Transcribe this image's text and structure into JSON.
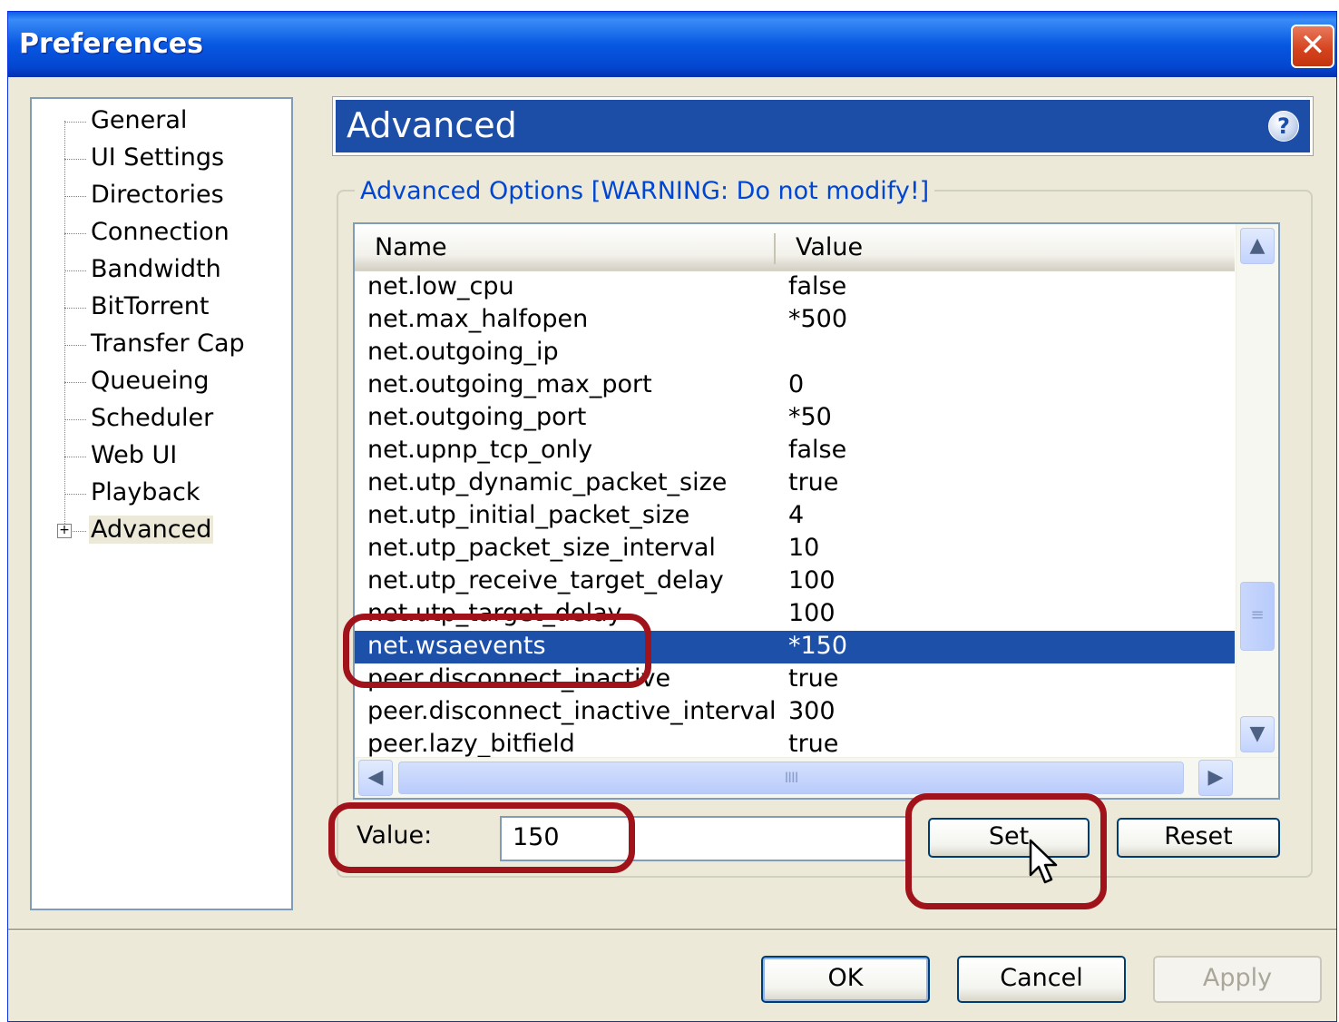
{
  "window": {
    "title": "Preferences"
  },
  "tree": {
    "items": [
      {
        "label": "General"
      },
      {
        "label": "UI Settings"
      },
      {
        "label": "Directories"
      },
      {
        "label": "Connection"
      },
      {
        "label": "Bandwidth"
      },
      {
        "label": "BitTorrent"
      },
      {
        "label": "Transfer Cap"
      },
      {
        "label": "Queueing"
      },
      {
        "label": "Scheduler"
      },
      {
        "label": "Web UI"
      },
      {
        "label": "Playback"
      },
      {
        "label": "Advanced",
        "selected": true,
        "expander": "+"
      }
    ]
  },
  "header": {
    "title": "Advanced",
    "help_icon": "?"
  },
  "group": {
    "legend": "Advanced Options [WARNING: Do not modify!]"
  },
  "list": {
    "columns": {
      "name": "Name",
      "value": "Value"
    },
    "rows": [
      {
        "name": "net.low_cpu",
        "value": "false"
      },
      {
        "name": "net.max_halfopen",
        "value": "*500"
      },
      {
        "name": "net.outgoing_ip",
        "value": ""
      },
      {
        "name": "net.outgoing_max_port",
        "value": "0"
      },
      {
        "name": "net.outgoing_port",
        "value": "*50"
      },
      {
        "name": "net.upnp_tcp_only",
        "value": "false"
      },
      {
        "name": "net.utp_dynamic_packet_size",
        "value": "true"
      },
      {
        "name": "net.utp_initial_packet_size",
        "value": "4"
      },
      {
        "name": "net.utp_packet_size_interval",
        "value": "10"
      },
      {
        "name": "net.utp_receive_target_delay",
        "value": "100"
      },
      {
        "name": "net.utp_target_delay",
        "value": "100"
      },
      {
        "name": "net.wsaevents",
        "value": "*150",
        "selected": true
      },
      {
        "name": "peer.disconnect_inactive",
        "value": "true"
      },
      {
        "name": "peer.disconnect_inactive_interval",
        "value": "300"
      },
      {
        "name": "peer.lazy_bitfield",
        "value": "true"
      }
    ],
    "scroll": {
      "up": "▲",
      "down": "▼",
      "left": "◀",
      "right": "▶",
      "grip_v": "≡",
      "grip_h": "IIII"
    }
  },
  "value_field": {
    "label": "Value:",
    "value": "150"
  },
  "buttons": {
    "set": "Set",
    "reset": "Reset",
    "ok": "OK",
    "cancel": "Cancel",
    "apply": "Apply"
  },
  "colors": {
    "titlebar": "#0858e2",
    "header_bar": "#1c4ea7",
    "selection": "#1d50a9",
    "highlight": "#a0131a",
    "legend": "#0046d5"
  }
}
